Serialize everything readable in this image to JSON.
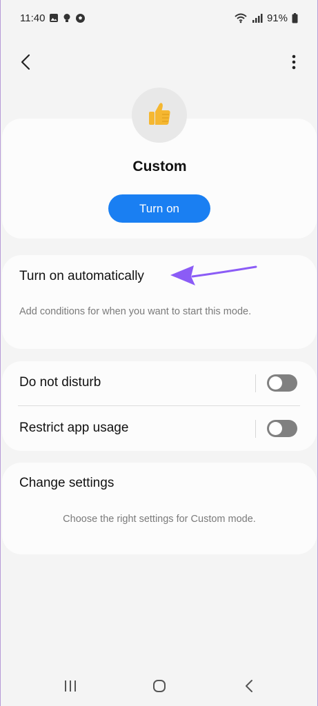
{
  "status_bar": {
    "time": "11:40",
    "battery": "91%",
    "icons": [
      "gallery-icon",
      "bulb-icon",
      "soccer-ball-icon",
      "wifi-icon",
      "signal-icon",
      "battery-icon"
    ]
  },
  "app_bar": {
    "back_icon": "chevron-left-icon",
    "more_icon": "more-vertical-icon"
  },
  "mode": {
    "icon": "thumbs-up-icon",
    "name": "Custom",
    "turn_on_label": "Turn on"
  },
  "auto": {
    "title": "Turn on automatically",
    "description": "Add conditions for when you want to start this mode."
  },
  "toggles": [
    {
      "label": "Do not disturb",
      "on": false
    },
    {
      "label": "Restrict app usage",
      "on": false
    }
  ],
  "change_settings": {
    "title": "Change settings",
    "description": "Choose the right settings for Custom mode."
  },
  "nav": {
    "recents_icon": "recents-icon",
    "home_icon": "home-icon",
    "back_icon": "nav-back-icon"
  },
  "colors": {
    "accent": "#1a7ff2",
    "annotation_arrow": "#8b5cf6",
    "switch_off": "#808080"
  }
}
